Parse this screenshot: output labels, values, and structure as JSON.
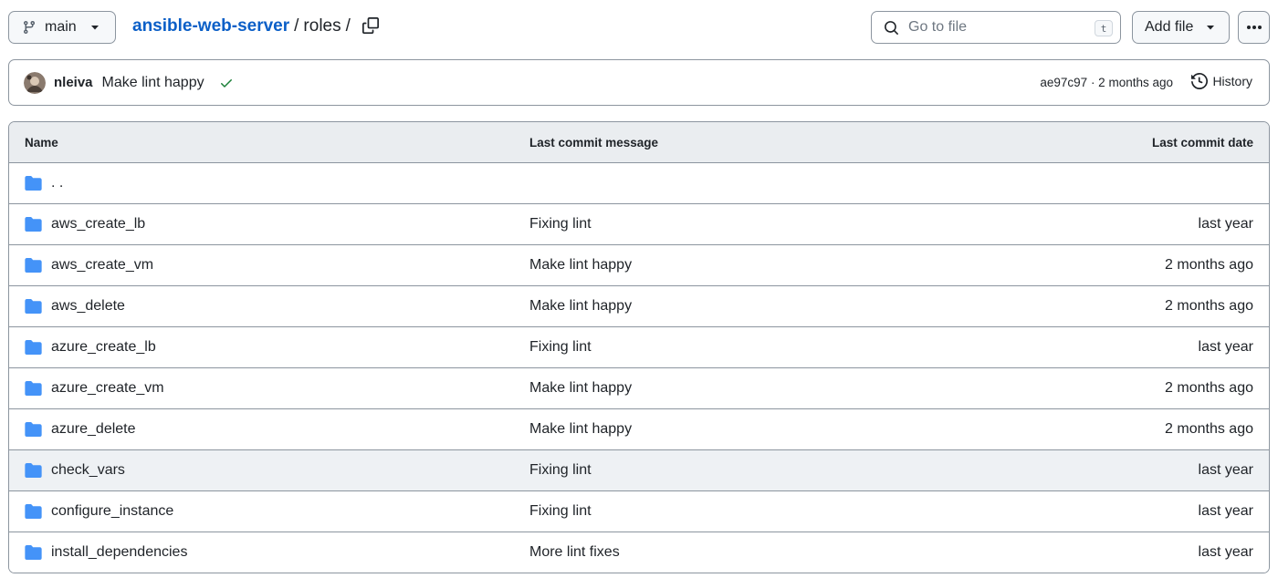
{
  "toolbar": {
    "branch_label": "main",
    "repo_name": "ansible-web-server",
    "sep1": "/",
    "current_dir": "roles",
    "sep2": "/",
    "search_placeholder": "Go to file",
    "search_shortcut": "t",
    "add_file_label": "Add file"
  },
  "commit": {
    "author": "nleiva",
    "message": "Make lint happy",
    "meta": "ae97c97 · 2 months ago",
    "history_label": "History"
  },
  "table": {
    "headers": {
      "name": "Name",
      "message": "Last commit message",
      "date": "Last commit date"
    },
    "parent_row": {
      "name": ". ."
    },
    "rows": [
      {
        "name": "aws_create_lb",
        "message": "Fixing lint",
        "date": "last year"
      },
      {
        "name": "aws_create_vm",
        "message": "Make lint happy",
        "date": "2 months ago"
      },
      {
        "name": "aws_delete",
        "message": "Make lint happy",
        "date": "2 months ago"
      },
      {
        "name": "azure_create_lb",
        "message": "Fixing lint",
        "date": "last year"
      },
      {
        "name": "azure_create_vm",
        "message": "Make lint happy",
        "date": "2 months ago"
      },
      {
        "name": "azure_delete",
        "message": "Make lint happy",
        "date": "2 months ago"
      },
      {
        "name": "check_vars",
        "message": "Fixing lint",
        "date": "last year"
      },
      {
        "name": "configure_instance",
        "message": "Fixing lint",
        "date": "last year"
      },
      {
        "name": "install_dependencies",
        "message": "More lint fixes",
        "date": "last year"
      }
    ]
  },
  "colors": {
    "folder": "#4493f8",
    "link": "#0b5fc7",
    "success": "#1a7f37",
    "border": "#8c959f",
    "header_bg": "#eaedf0"
  },
  "icons": {
    "branch": "git-branch-icon",
    "caret": "triangle-down-icon",
    "copy": "copy-icon",
    "search": "search-icon",
    "more": "kebab-horizontal-icon",
    "check": "check-icon",
    "history": "history-icon",
    "folder": "folder-icon"
  }
}
